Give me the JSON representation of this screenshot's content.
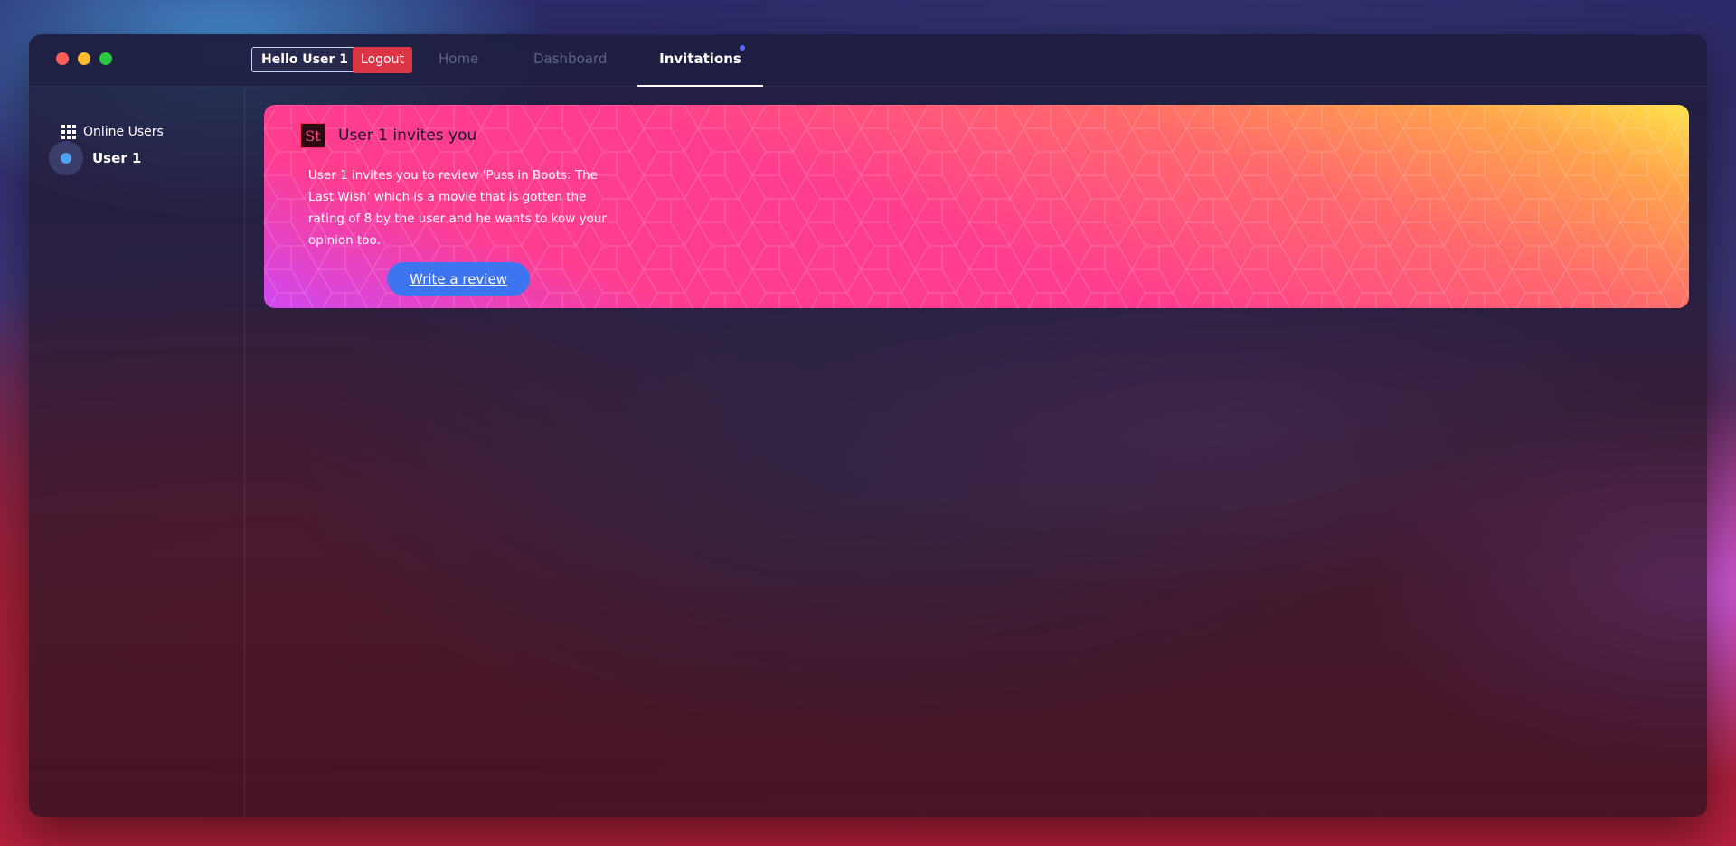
{
  "window": {
    "traffic_lights": [
      "close",
      "minimize",
      "maximize"
    ]
  },
  "header": {
    "greeting": "Hello User 1",
    "logout_label": "Logout",
    "tabs": [
      {
        "label": "Home",
        "active": false
      },
      {
        "label": "Dashboard",
        "active": false
      },
      {
        "label": "Invitations",
        "active": true,
        "has_notification": true
      }
    ]
  },
  "sidebar": {
    "title": "Online Users",
    "title_icon": "grid-icon",
    "users": [
      {
        "name": "User 1",
        "status_color": "#4ea3f0"
      }
    ]
  },
  "invitation": {
    "icon_text": "St",
    "title": "User 1 invites you",
    "body": "User 1 invites you to review 'Puss in Boots: The Last Wish' which is a movie that is gotten the rating of 8 by the user and he wants to kow your opinion too.",
    "action_label": "Write a review"
  },
  "colors": {
    "logout": "#dc3545",
    "action_button": "#3d74f0",
    "notification_dot": "#5b6df5"
  }
}
